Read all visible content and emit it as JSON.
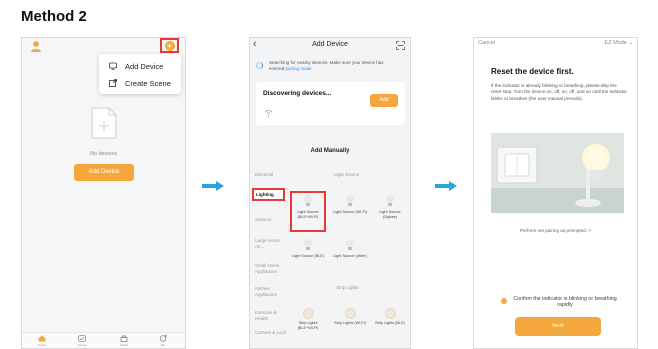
{
  "page": {
    "title": "Method 2"
  },
  "colors": {
    "accent": "#f4a73c",
    "highlight": "#e53935",
    "arrow": "#2aa4dc"
  },
  "screen1": {
    "menu": {
      "add_device": "Add Device",
      "create_scene": "Create Scene"
    },
    "empty_text": "No devices",
    "add_device_button": "Add Device",
    "tabs": [
      {
        "icon": "home-icon",
        "label": "Home"
      },
      {
        "icon": "scene-icon",
        "label": "Scene"
      },
      {
        "icon": "smart-icon",
        "label": "Smart"
      },
      {
        "icon": "me-icon",
        "label": "Me"
      }
    ]
  },
  "screen2": {
    "title": "Add Device",
    "search_text": "Searching for nearby devices. Make sure your device has entered",
    "search_link": "pairing mode.",
    "discovering": "Discovering devices...",
    "discover_add": "Add",
    "add_manually": "Add Manually",
    "categories": [
      "Electrical",
      "Lighting",
      "Sensors",
      "Large Home Ap...",
      "Small Home Appliances",
      "Kitchen Appliances",
      "Exercise & Health",
      "Camera & Lock"
    ],
    "section_light_source": "Light Source",
    "section_strip_lights": "Strip Lights",
    "items": {
      "ls_ble_wifi": "Light Source (BLE+Wi-Fi)",
      "ls_wifi": "Light Source (Wi-Fi)",
      "ls_zigbee": "Light Source (Zigbee)",
      "ls_ble": "Light Source (BLE)",
      "ls_other": "Light Source (other)",
      "strip_ble_wifi": "Strip Lights (BLE+Wi-Fi)",
      "strip_wifi": "Strip Lights (Wi-Fi)",
      "strip_ble": "Strip Lights (BLE)"
    }
  },
  "screen3": {
    "cancel": "Cancel",
    "ez_mode": "EZ Mode",
    "reset_title": "Reset the device first.",
    "reset_text": "If the indicator is already blinking or breathing, please skip the reset step. Turn the device on, off, on, off, and on until the indicator blinks or breathes (the user manual prevails).",
    "perform_text": "Perform net pairing as prompted. >",
    "confirm_text": "Confirm the indicator is blinking or breathing rapidly",
    "next_button": "Next"
  }
}
